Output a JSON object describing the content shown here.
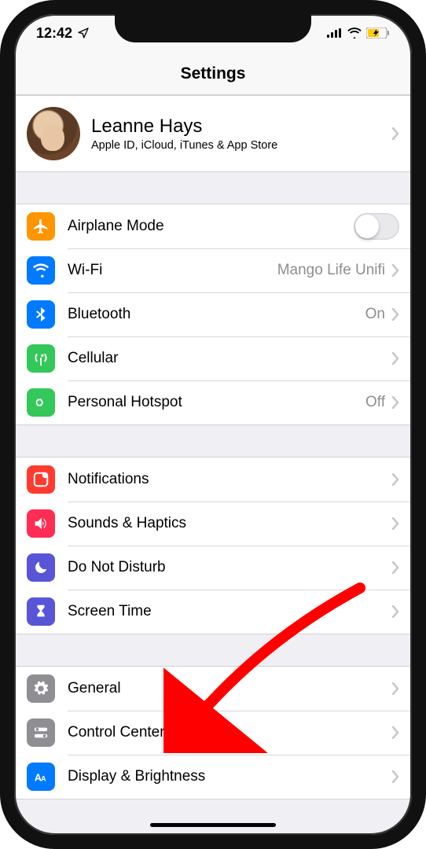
{
  "status": {
    "time": "12:42",
    "location_icon": "location-arrow",
    "signal_bars": 4,
    "wifi": true,
    "battery_low_power": true
  },
  "header": {
    "title": "Settings"
  },
  "profile": {
    "name": "Leanne Hays",
    "subtitle": "Apple ID, iCloud, iTunes & App Store"
  },
  "groups": [
    {
      "rows": [
        {
          "id": "airplane",
          "label": "Airplane Mode",
          "icon": "airplane",
          "color": "#ff9500",
          "control": "toggle",
          "toggled": false
        },
        {
          "id": "wifi",
          "label": "Wi-Fi",
          "detail": "Mango Life Unifi",
          "icon": "wifi",
          "color": "#007aff",
          "control": "chevron"
        },
        {
          "id": "bluetooth",
          "label": "Bluetooth",
          "detail": "On",
          "icon": "bluetooth",
          "color": "#007aff",
          "control": "chevron"
        },
        {
          "id": "cellular",
          "label": "Cellular",
          "icon": "antenna",
          "color": "#34c759",
          "control": "chevron"
        },
        {
          "id": "hotspot",
          "label": "Personal Hotspot",
          "detail": "Off",
          "icon": "link",
          "color": "#34c759",
          "control": "chevron"
        }
      ]
    },
    {
      "rows": [
        {
          "id": "notifications",
          "label": "Notifications",
          "icon": "notification",
          "color": "#ff3b30",
          "control": "chevron"
        },
        {
          "id": "sounds",
          "label": "Sounds & Haptics",
          "icon": "speaker",
          "color": "#ff2d55",
          "control": "chevron"
        },
        {
          "id": "dnd",
          "label": "Do Not Disturb",
          "icon": "moon",
          "color": "#5856d6",
          "control": "chevron"
        },
        {
          "id": "screentime",
          "label": "Screen Time",
          "icon": "hourglass",
          "color": "#5856d6",
          "control": "chevron"
        }
      ]
    },
    {
      "rows": [
        {
          "id": "general",
          "label": "General",
          "icon": "gear",
          "color": "#8e8e93",
          "control": "chevron"
        },
        {
          "id": "controlcenter",
          "label": "Control Center",
          "icon": "switches",
          "color": "#8e8e93",
          "control": "chevron"
        },
        {
          "id": "display",
          "label": "Display & Brightness",
          "icon": "aa",
          "color": "#007aff",
          "control": "chevron"
        }
      ]
    }
  ],
  "annotation": {
    "arrow_points_to": "general"
  }
}
